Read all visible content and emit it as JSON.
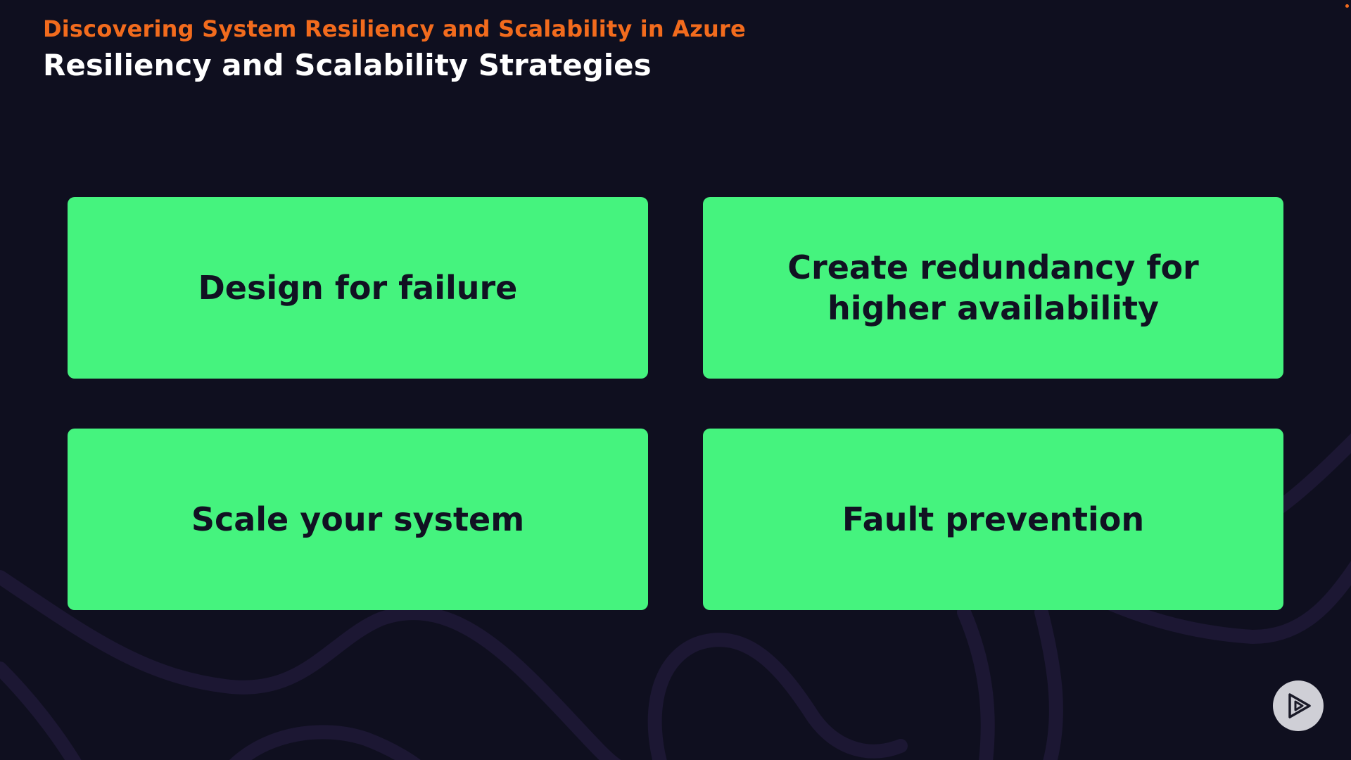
{
  "header": {
    "course_title": "Discovering System Resiliency and Scalability in Azure",
    "slide_title": "Resiliency and Scalability Strategies"
  },
  "cards": [
    {
      "label": "Design for failure"
    },
    {
      "label": "Create redundancy for higher availability"
    },
    {
      "label": "Scale your system"
    },
    {
      "label": "Fault prevention"
    }
  ],
  "controls": {
    "play_icon": "play-icon"
  },
  "colors": {
    "background": "#0f0f1f",
    "accent_orange": "#f26b1d",
    "card_green": "#45f37e",
    "card_text": "#111122",
    "swirl": "#1c1733"
  }
}
